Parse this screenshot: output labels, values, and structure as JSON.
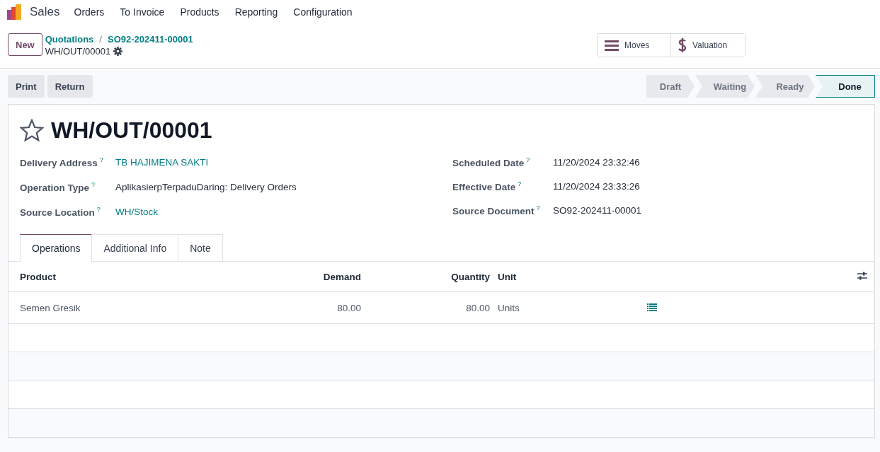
{
  "navbar": {
    "app": "Sales",
    "menu": [
      "Orders",
      "To Invoice",
      "Products",
      "Reporting",
      "Configuration"
    ]
  },
  "control_panel": {
    "new_button": "New",
    "breadcrumbs": [
      "Quotations",
      "SO92-202411-00001"
    ],
    "breadcrumb_separator": "/",
    "record": "WH/OUT/00001",
    "smart_buttons": [
      {
        "kind": "moves",
        "label": "Moves"
      },
      {
        "kind": "valuation",
        "label": "Valuation"
      }
    ]
  },
  "actions": [
    "Print",
    "Return"
  ],
  "statusbar": [
    {
      "label": "Draft",
      "selected": false
    },
    {
      "label": "Waiting",
      "selected": false
    },
    {
      "label": "Ready",
      "selected": false
    },
    {
      "label": "Done",
      "selected": true
    }
  ],
  "form": {
    "title": "WH/OUT/00001",
    "favorite": false,
    "left_fields": [
      {
        "label": "Delivery Address",
        "help": "?",
        "value": "TB HAJIMENA SAKTI",
        "kind": "link"
      },
      {
        "label": "Operation Type",
        "help": "?",
        "value": "AplikasierpTerpaduDaring: Delivery Orders",
        "kind": "text"
      },
      {
        "label": "Source Location",
        "help": "?",
        "value": "WH/Stock",
        "kind": "link"
      }
    ],
    "right_fields": [
      {
        "label": "Scheduled Date",
        "help": "?",
        "value": "11/20/2024 23:32:46"
      },
      {
        "label": "Effective Date",
        "help": "?",
        "value": "11/20/2024 23:33:26"
      },
      {
        "label": "Source Document",
        "help": "?",
        "value": "SO92-202411-00001"
      }
    ]
  },
  "tabs": [
    {
      "label": "Operations",
      "selected": true
    },
    {
      "label": "Additional Info",
      "selected": false
    },
    {
      "label": "Note",
      "selected": false
    }
  ],
  "table": {
    "columns": [
      "Product",
      "Demand",
      "Quantity",
      "Unit"
    ],
    "rows": [
      {
        "product": "Semen Gresik",
        "demand": "80.00",
        "quantity": "80.00",
        "unit": "Units"
      }
    ]
  }
}
